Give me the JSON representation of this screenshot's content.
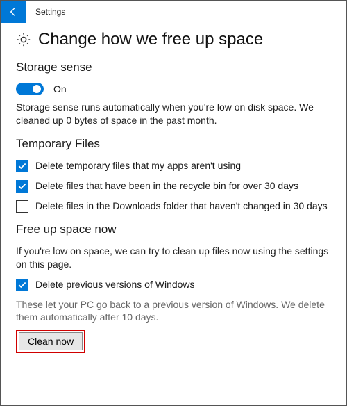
{
  "app_title": "Settings",
  "page_title": "Change how we free up space",
  "storage_sense": {
    "heading": "Storage sense",
    "toggle_label": "On",
    "toggle_on": true,
    "description": "Storage sense runs automatically when you're low on disk space. We cleaned up 0 bytes of space in the past month."
  },
  "temp_files": {
    "heading": "Temporary Files",
    "options": [
      {
        "label": "Delete temporary files that my apps aren't using",
        "checked": true
      },
      {
        "label": "Delete files that have been in the recycle bin for over 30 days",
        "checked": true
      },
      {
        "label": "Delete files in the Downloads folder that haven't changed in 30 days",
        "checked": false
      }
    ]
  },
  "free_up": {
    "heading": "Free up space now",
    "description": "If you're low on space, we can try to clean up files now using the settings on this page.",
    "prev_versions": {
      "label": "Delete previous versions of Windows",
      "checked": true
    },
    "note": "These let your PC go back to a previous version of Windows. We delete them automatically after 10 days.",
    "button_label": "Clean now"
  }
}
